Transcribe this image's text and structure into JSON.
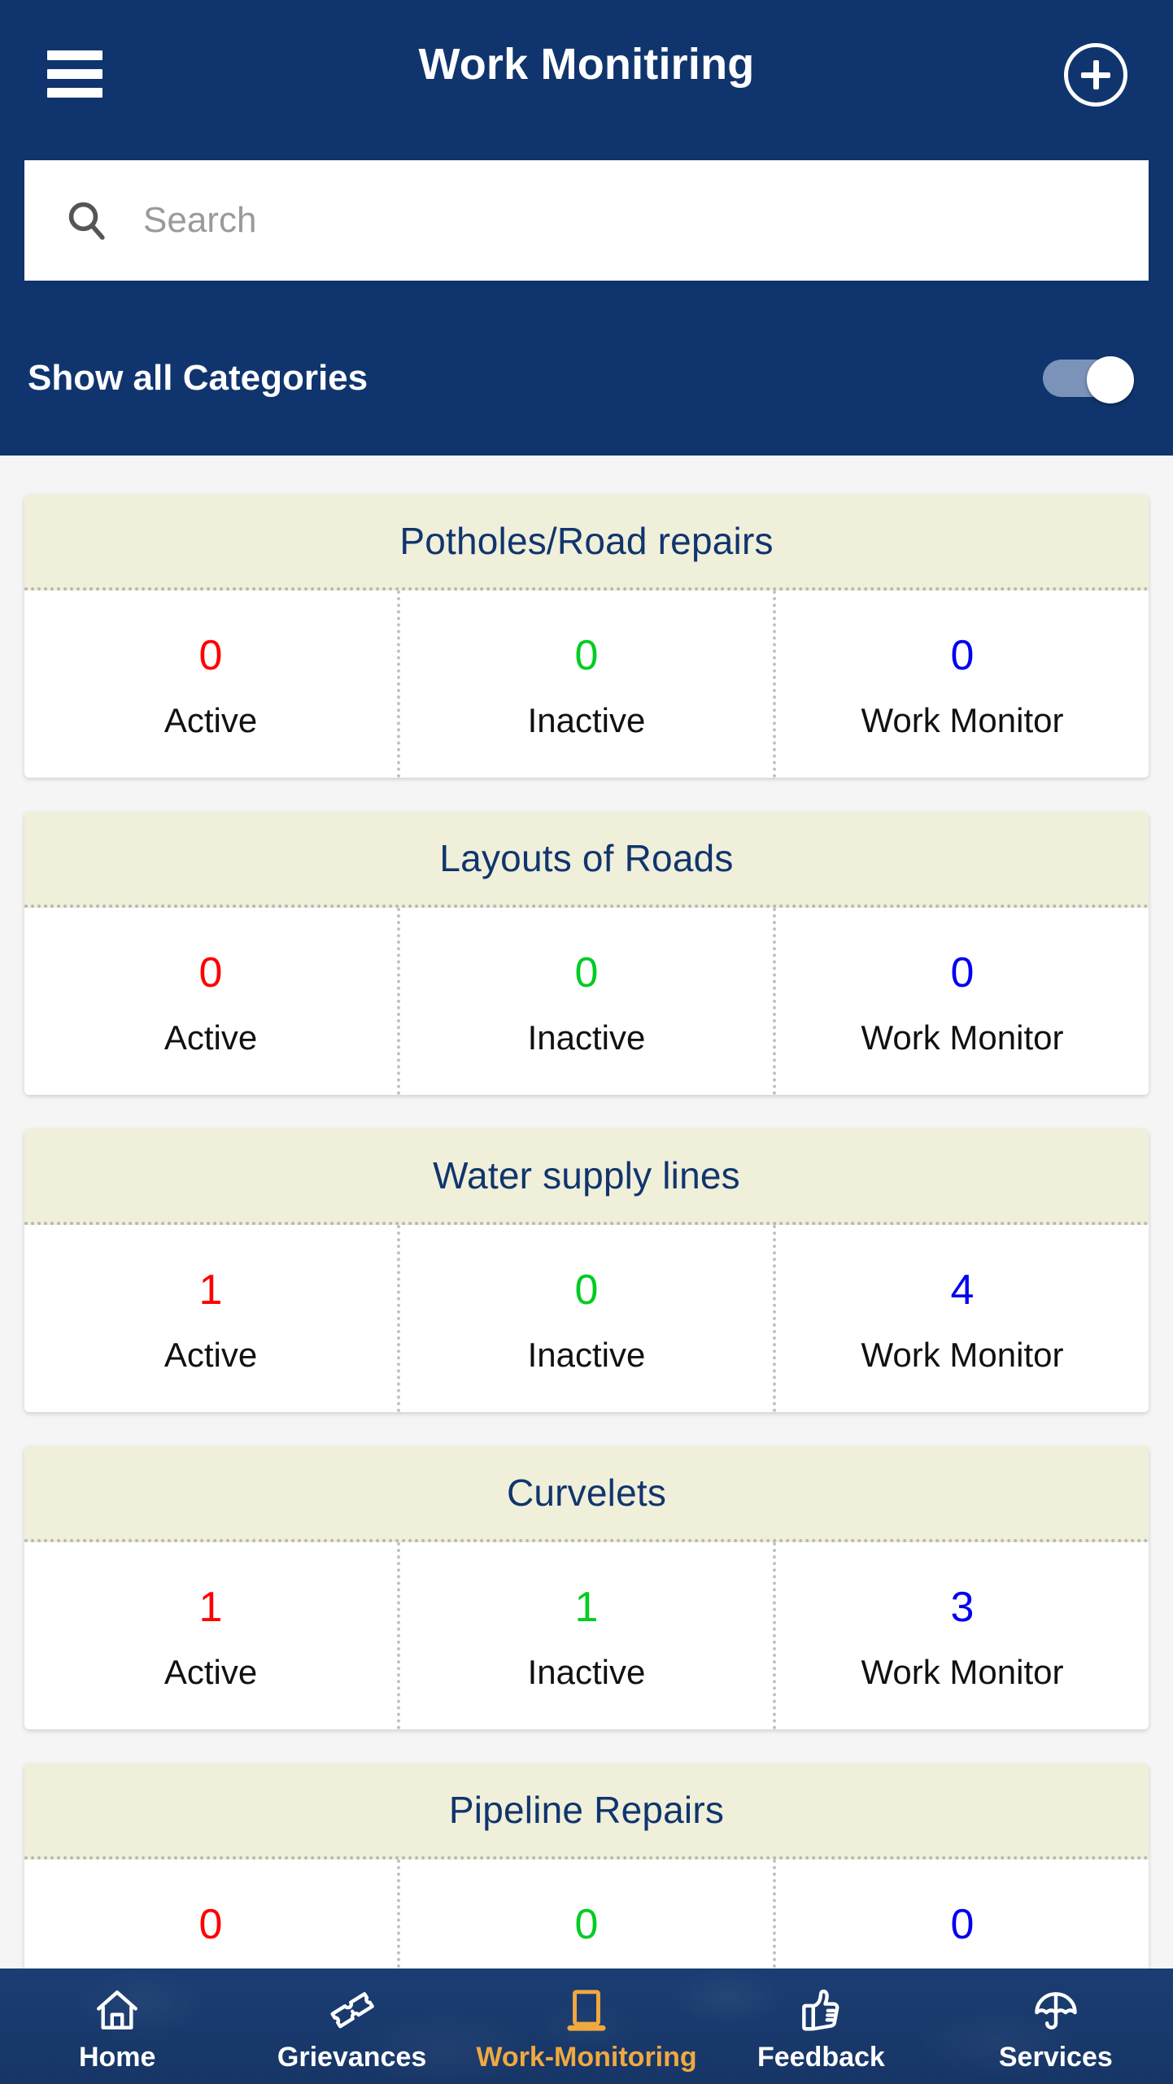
{
  "header": {
    "title": "Work Monitiring",
    "menu_icon": "hamburger-menu-icon",
    "add_icon": "plus-circle-icon"
  },
  "search": {
    "placeholder": "Search",
    "value": "",
    "icon": "search-icon"
  },
  "filter": {
    "label": "Show all Categories",
    "toggle_state": "on"
  },
  "colors": {
    "header_bg": "#10356e",
    "card_head_bg": "#f0efd9",
    "card_title": "#10356e",
    "active_value": "#ff0000",
    "inactive_value": "#00cc22",
    "monitor_value": "#0000ee",
    "nav_active": "#f0a93f",
    "nav_bg": "#1b3d72"
  },
  "stat_labels": {
    "active": "Active",
    "inactive": "Inactive",
    "monitor": "Work Monitor"
  },
  "cards": [
    {
      "title": "Potholes/Road repairs",
      "active": "0",
      "inactive": "0",
      "monitor": "0"
    },
    {
      "title": "Layouts of Roads",
      "active": "0",
      "inactive": "0",
      "monitor": "0"
    },
    {
      "title": "Water supply lines",
      "active": "1",
      "inactive": "0",
      "monitor": "4"
    },
    {
      "title": "Curvelets",
      "active": "1",
      "inactive": "1",
      "monitor": "3"
    },
    {
      "title": "Pipeline Repairs",
      "active": "0",
      "inactive": "0",
      "monitor": "0"
    }
  ],
  "bottom_nav": {
    "items": [
      {
        "label": "Home",
        "icon": "home-icon",
        "active": false
      },
      {
        "label": "Grievances",
        "icon": "ticket-icon",
        "active": false
      },
      {
        "label": "Work-Monitoring",
        "icon": "tablet-icon",
        "active": true
      },
      {
        "label": "Feedback",
        "icon": "thumbs-up-icon",
        "active": false
      },
      {
        "label": "Services",
        "icon": "umbrella-icon",
        "active": false
      }
    ]
  }
}
